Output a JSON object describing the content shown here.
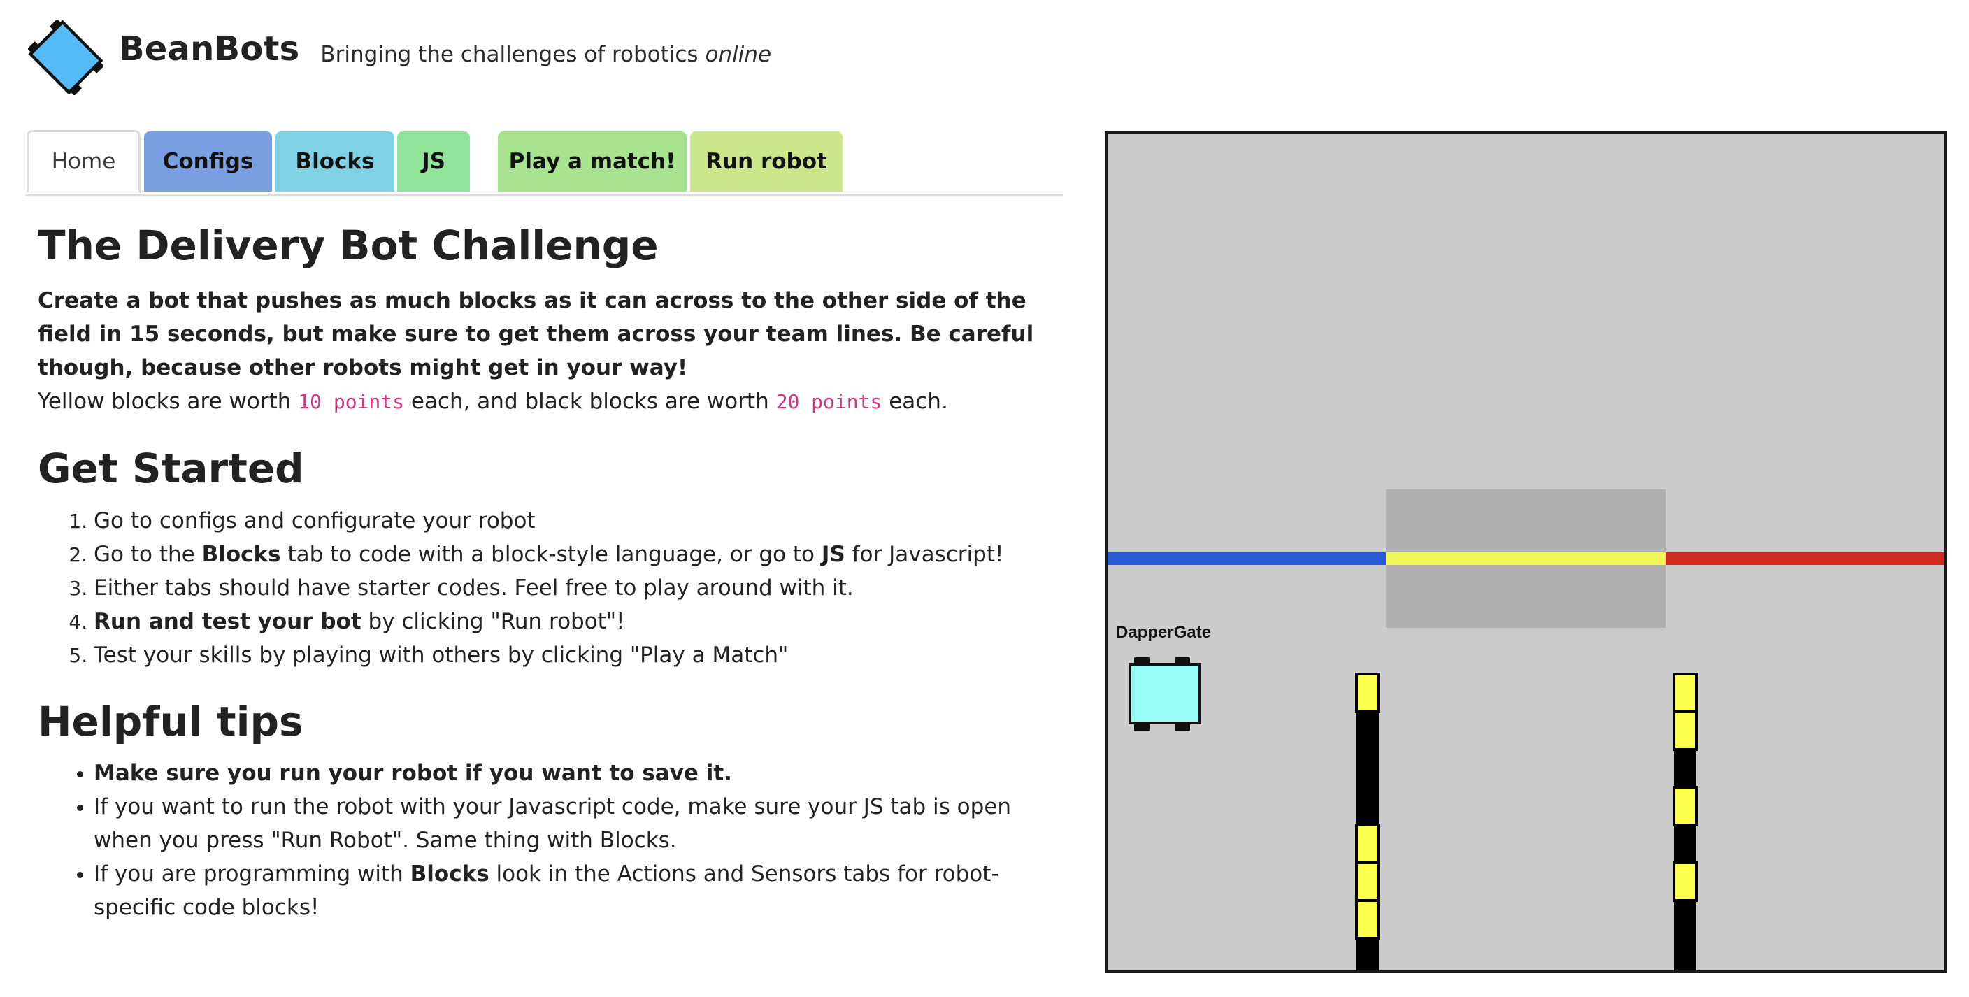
{
  "header": {
    "brand": "BeanBots",
    "tagline_prefix": "Bringing the challenges of robotics",
    "tagline_emphasis": "online",
    "logo_icon": "robot-logo-icon",
    "logo_color": "#55bbf7"
  },
  "tabs": [
    {
      "label": "Home",
      "color": "#ffffff",
      "active": true
    },
    {
      "label": "Configs",
      "color": "#7aa0e3"
    },
    {
      "label": "Blocks",
      "color": "#7fd2e6"
    },
    {
      "label": "JS",
      "color": "#92e49a"
    },
    {
      "label": "Play a match!",
      "color": "#a8e490"
    },
    {
      "label": "Run robot",
      "color": "#cde68a"
    }
  ],
  "challenge": {
    "title": "The Delivery Bot Challenge",
    "intro": "Create a bot that pushes as much blocks as it can across to the other side of the field in 15 seconds, but make sure to get them across your team lines. Be careful though, because other robots might get in your way!",
    "points_part1": "Yellow blocks are worth",
    "yellow_points": "10 points",
    "points_part2": "each, and black blocks are worth",
    "black_points": "20 points",
    "points_part3": "each."
  },
  "get_started": {
    "title": "Get Started",
    "steps": [
      {
        "text": "Go to configs and configurate your robot"
      },
      {
        "pre": "Go to the",
        "bold1": "Blocks",
        "mid": "tab to code with a block-style language, or go to",
        "bold2": "JS",
        "post": "for Javascript!"
      },
      {
        "text": "Either tabs should have starter codes. Feel free to play around with it."
      },
      {
        "bold": "Run and test your bot",
        "rest": "by clicking \"Run robot\"!"
      },
      {
        "text": "Test your skills by playing with others by clicking \"Play a Match\""
      }
    ]
  },
  "tips": {
    "title": "Helpful tips",
    "items": [
      {
        "bold": "Make sure you run your robot if you want to save it."
      },
      {
        "text": "If you want to run the robot with your Javascript code, make sure your JS tab is open when you press \"Run Robot\". Same thing with Blocks."
      },
      {
        "pre": "If you are programming with",
        "bold": "Blocks",
        "post": "look in the Actions and Sensors tabs for robot-specific code blocks!"
      }
    ]
  },
  "field": {
    "robot_name": "DapperGate",
    "colors": {
      "background": "#cccccc",
      "center_zone": "#b0b0b0",
      "blue_line": "#2a5bd7",
      "yellow_line": "#f0f558",
      "red_line": "#cf2b22",
      "robot_body": "#9afcf8",
      "block_yellow": "#ffff4d",
      "block_black": "#000000"
    }
  }
}
